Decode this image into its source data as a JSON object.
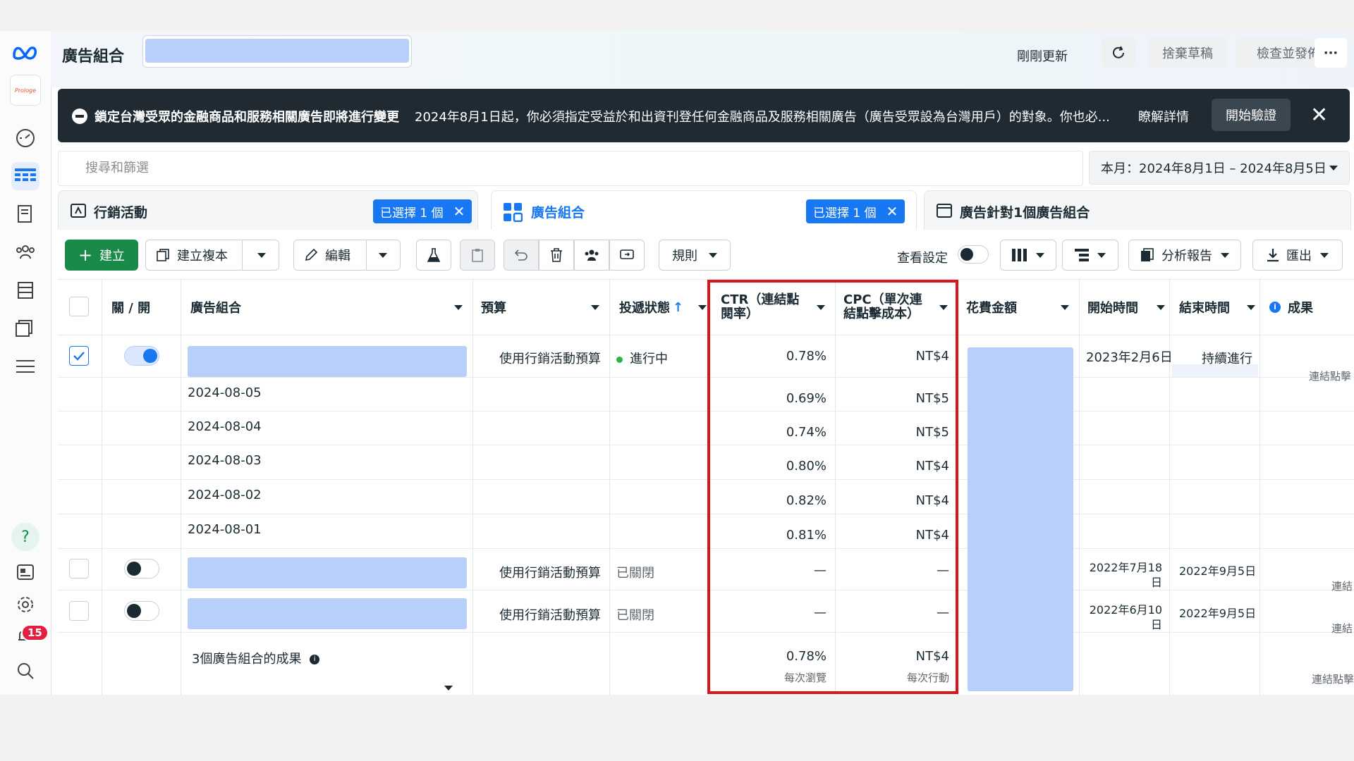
{
  "header": {
    "title": "廣告組合",
    "updated": "剛剛更新",
    "discard": "捨棄草稿",
    "review_publish": "檢查並發佈",
    "more": "···"
  },
  "banner": {
    "title": "鎖定台灣受眾的金融商品和服務相關廣告即將進行變更",
    "body": "2024年8月1日起，你必須指定受益於和出資刊登任何金融商品及服務相關廣告（廣告受眾設為台灣用戶）的對象。你也必...",
    "learn_more": "瞭解詳情",
    "start_verify": "開始驗證",
    "close": "✕"
  },
  "search": {
    "placeholder": "搜尋和篩選"
  },
  "date_range": "本月：2024年8月1日 – 2024年8月5日",
  "tabs": [
    {
      "label": "行銷活動",
      "selected": "已選擇 1 個"
    },
    {
      "label": "廣告組合",
      "selected": "已選擇 1 個"
    },
    {
      "label": "廣告針對1個廣告組合"
    }
  ],
  "toolbar": {
    "create": "建立",
    "duplicate": "建立複本",
    "edit": "編輯",
    "rules": "規則",
    "view_settings": "查看設定",
    "reports": "分析報告",
    "export": "匯出"
  },
  "columns": {
    "onoff": "關 / 開",
    "adset": "廣告組合",
    "budget": "預算",
    "delivery": "投遞狀態",
    "delivery_sort": "↑",
    "ctr_1": "CTR（連結點",
    "ctr_2": "閱率）",
    "cpc_1": "CPC（單次連",
    "cpc_2": "結點擊成本）",
    "spend": "花費金額",
    "start": "開始時間",
    "end": "結束時間",
    "results": "成果"
  },
  "rows": {
    "main": {
      "budget": "使用行銷活動預算",
      "status": "進行中",
      "ctr": "0.78%",
      "cpc": "NT$4",
      "start": "2023年2月6日",
      "end": "持續進行",
      "results": "連結點擊"
    },
    "daily": [
      {
        "date": "2024-08-05",
        "ctr": "0.69%",
        "cpc": "NT$5"
      },
      {
        "date": "2024-08-04",
        "ctr": "0.74%",
        "cpc": "NT$5"
      },
      {
        "date": "2024-08-03",
        "ctr": "0.80%",
        "cpc": "NT$4"
      },
      {
        "date": "2024-08-02",
        "ctr": "0.82%",
        "cpc": "NT$4"
      },
      {
        "date": "2024-08-01",
        "ctr": "0.81%",
        "cpc": "NT$4"
      }
    ],
    "off1": {
      "budget": "使用行銷活動預算",
      "status": "已關閉",
      "ctr": "—",
      "cpc": "—",
      "start_1": "2022年7月18",
      "start_2": "日",
      "end": "2022年9月5日",
      "results": "連結"
    },
    "off2": {
      "budget": "使用行銷活動預算",
      "status": "已關閉",
      "ctr": "—",
      "cpc": "—",
      "start_1": "2022年6月10",
      "start_2": "日",
      "end": "2022年9月5日",
      "results": "連結"
    }
  },
  "summary": {
    "label": "3個廣告組合的成果",
    "ctr": "0.78%",
    "ctr_sub": "每次瀏覽",
    "cpc": "NT$4",
    "cpc_sub": "每次行動",
    "results": "連結點擊"
  },
  "notifications": {
    "count": "15"
  },
  "colors": {
    "accent": "#1877f2",
    "create_green": "#1a8a4a",
    "highlight_red": "#d9161b",
    "placeholder_blue": "#b8cffa"
  }
}
